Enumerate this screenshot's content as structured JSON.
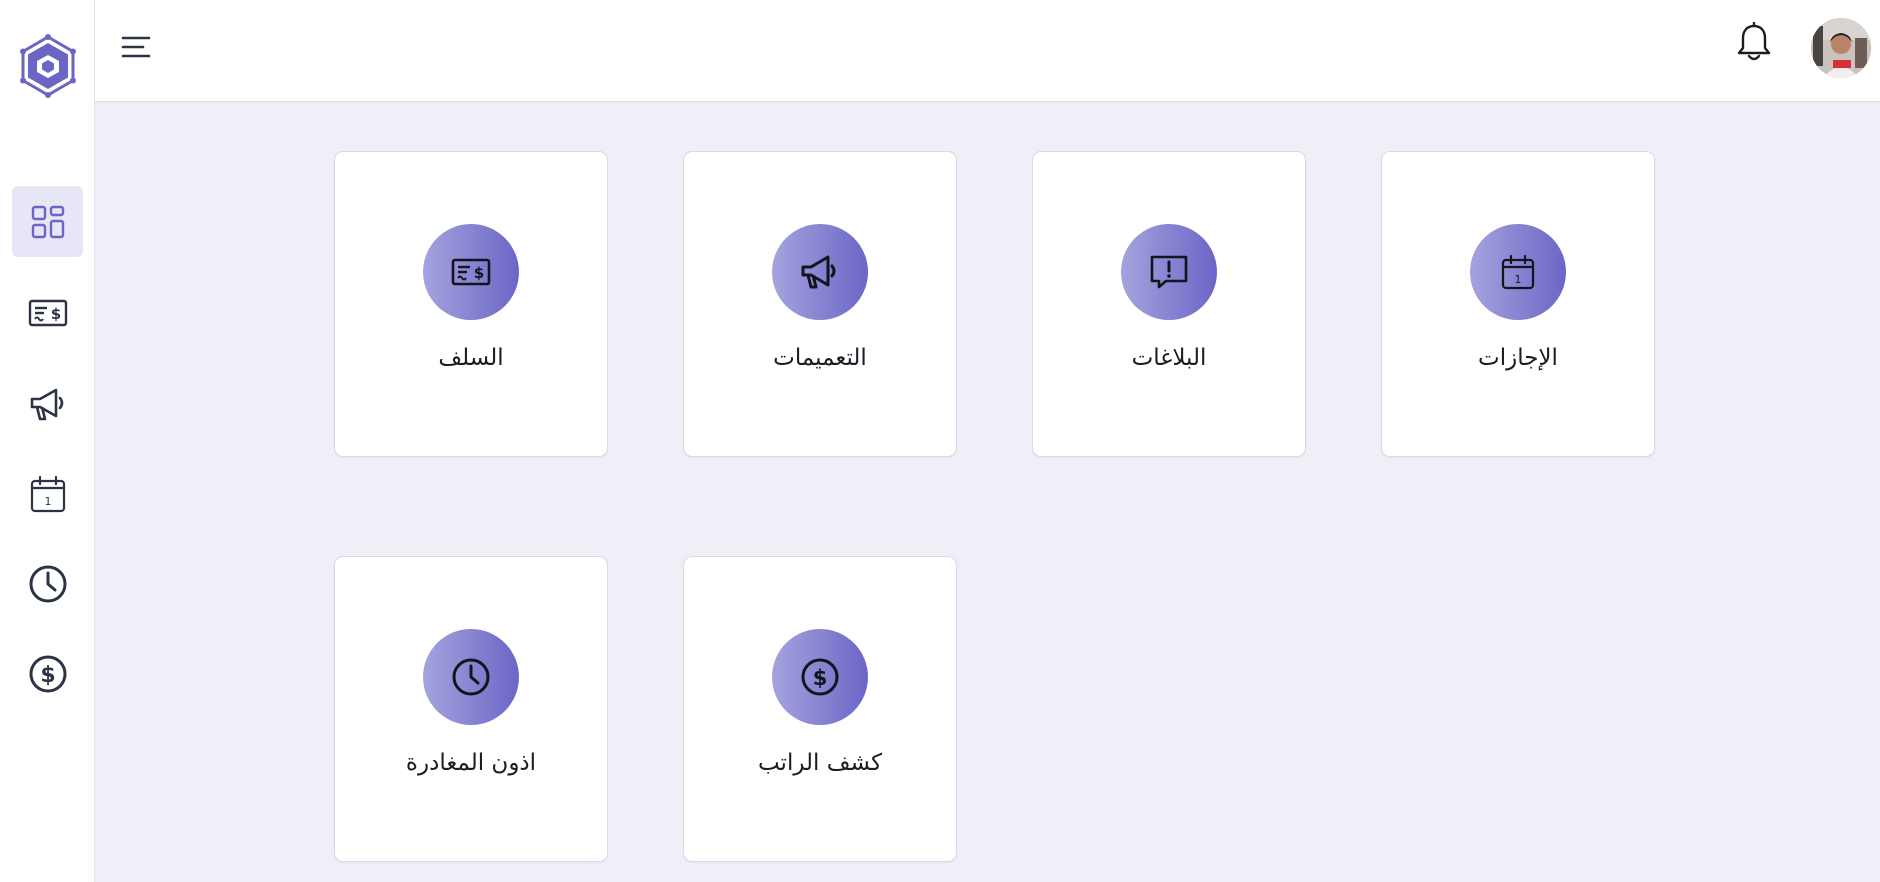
{
  "colors": {
    "accent": "#6b66c6",
    "accent_light": "#a5a3de",
    "page_background": "#eff0f7",
    "icon_dark": "#2b3444"
  },
  "sidebar": {
    "logo": "hexagon-logo",
    "items": [
      {
        "icon": "dashboard-grid-icon",
        "active": true
      },
      {
        "icon": "check-payment-icon",
        "active": false
      },
      {
        "icon": "megaphone-icon",
        "active": false
      },
      {
        "icon": "calendar-icon",
        "active": false
      },
      {
        "icon": "clock-icon",
        "active": false
      },
      {
        "icon": "dollar-circle-icon",
        "active": false
      }
    ]
  },
  "header": {
    "menu_icon": "hamburger-icon",
    "notification_icon": "bell-icon",
    "avatar": "user-avatar"
  },
  "cards": [
    {
      "label": "الإجازات",
      "icon": "calendar-icon"
    },
    {
      "label": "البلاغات",
      "icon": "alert-message-icon"
    },
    {
      "label": "التعميمات",
      "icon": "megaphone-icon"
    },
    {
      "label": "السلف",
      "icon": "check-payment-icon"
    },
    {
      "label": "كشف الراتب",
      "icon": "dollar-circle-icon"
    },
    {
      "label": "اذون المغادرة",
      "icon": "clock-icon"
    }
  ]
}
